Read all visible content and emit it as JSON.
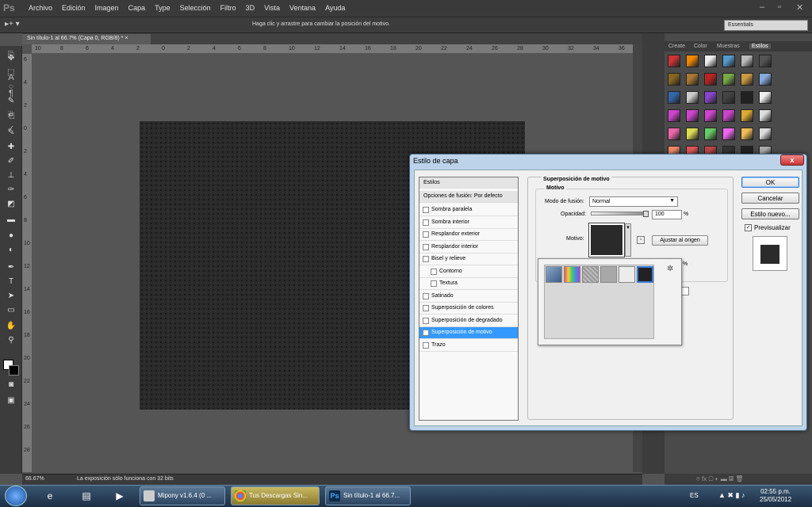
{
  "app": {
    "logo": "Ps"
  },
  "menu": [
    "Archivo",
    "Edición",
    "Imagen",
    "Capa",
    "Type",
    "Selección",
    "Filtro",
    "3D",
    "Vista",
    "Ventana",
    "Ayuda"
  ],
  "options": {
    "hint": "Haga clic y arrastre para cambiar la posición del motivo.",
    "workspace": "Essentials"
  },
  "document": {
    "tab": "Sin título-1 al 66.7% (Capa 0, RGB/8) *"
  },
  "rulers": {
    "h": [
      "10",
      "8",
      "6",
      "4",
      "2",
      "0",
      "2",
      "4",
      "6",
      "8",
      "10",
      "12",
      "14",
      "16",
      "18",
      "20",
      "22",
      "24",
      "26",
      "28",
      "30",
      "32",
      "34",
      "36"
    ],
    "v": [
      "6",
      "4",
      "2",
      "0",
      "2",
      "4",
      "6",
      "8",
      "10",
      "12",
      "14",
      "16",
      "18",
      "20",
      "22",
      "24",
      "26",
      "28"
    ]
  },
  "status": {
    "zoom": "66.67%",
    "message": "La exposición sólo funciona con 32 bits"
  },
  "panel": {
    "tabs": [
      "Create",
      "Color",
      "Muestras",
      "Estilos"
    ]
  },
  "dialog": {
    "title": "Estilo de capa",
    "close": "x",
    "list": {
      "header": "Estilos",
      "blend_options": "Opciones de fusión: Por defecto",
      "items": [
        {
          "label": "Sombra paralela",
          "checked": ""
        },
        {
          "label": "Sombra interior",
          "checked": ""
        },
        {
          "label": "Resplandor exterior",
          "checked": ""
        },
        {
          "label": "Resplandor interior",
          "checked": ""
        },
        {
          "label": "Bisel y relieve",
          "checked": ""
        },
        {
          "label": "Contorno",
          "checked": ""
        },
        {
          "label": "Textura",
          "checked": ""
        },
        {
          "label": "Satinado",
          "checked": ""
        },
        {
          "label": "Superposición de colores",
          "checked": ""
        },
        {
          "label": "Superposición de degradado",
          "checked": ""
        },
        {
          "label": "Superposición de motivo",
          "checked": "✓"
        },
        {
          "label": "Trazo",
          "checked": ""
        }
      ]
    },
    "section_title": "Superposición de motivo",
    "subsection_title": "Motivo",
    "blend_label": "Modo de fusión:",
    "blend_value": "Normal",
    "opacity_label": "Opacidad:",
    "opacity_value": "100",
    "opacity_fraction": 1.0,
    "percent": "%",
    "pattern_label": "Motivo:",
    "snap_button": "Ajustar al origen",
    "buttons": {
      "ok": "OK",
      "cancel": "Cancelar",
      "new_style": "Estilo nuevo...",
      "preview": "Previsualizar",
      "preview_checked": "✓"
    }
  },
  "taskbar": {
    "items": [
      {
        "label": "Mipony v1.6.4 (0 ..."
      },
      {
        "label": "Tus Descargas Sin..."
      },
      {
        "label": "Sin título-1 al 66.7..."
      }
    ],
    "lang": "ES",
    "time": "02:55 p.m.",
    "date": "25/05/2012"
  }
}
